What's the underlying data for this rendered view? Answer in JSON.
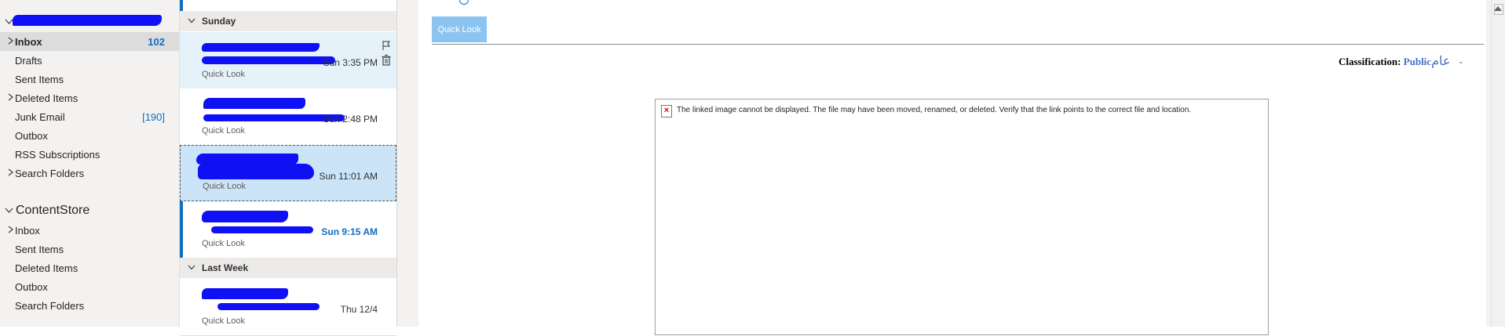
{
  "folder_pane": {
    "account1": {
      "items": [
        {
          "label": "Inbox",
          "count": "102",
          "chevron": true,
          "bold": true,
          "selected": true
        },
        {
          "label": "Drafts"
        },
        {
          "label": "Sent Items"
        },
        {
          "label": "Deleted Items",
          "chevron": true
        },
        {
          "label": "Junk Email",
          "count": "[190]"
        },
        {
          "label": "Outbox"
        },
        {
          "label": "RSS Subscriptions"
        },
        {
          "label": "Search Folders",
          "chevron": true
        }
      ]
    },
    "account2": {
      "name": "ContentStore",
      "items": [
        {
          "label": "Inbox",
          "chevron": true
        },
        {
          "label": "Sent Items"
        },
        {
          "label": "Deleted Items"
        },
        {
          "label": "Outbox"
        },
        {
          "label": "Search Folders"
        }
      ]
    }
  },
  "message_list": {
    "groups": [
      {
        "title": "Sunday"
      },
      {
        "title": "Last Week"
      }
    ],
    "messages": [
      {
        "time": "Sun 3:35 PM",
        "preview": "Quick Look",
        "state": "hover"
      },
      {
        "time": "Sun 2:48 PM",
        "preview": "Quick Look"
      },
      {
        "time": "Sun 11:01 AM",
        "preview": "Quick Look",
        "state": "selected"
      },
      {
        "time": "Sun 9:15 AM",
        "preview": "Quick Look",
        "state": "unread"
      },
      {
        "time": "Thu 12/4",
        "preview": "Quick Look"
      }
    ]
  },
  "reading_pane": {
    "quick_look_button": "Quick Look",
    "classification": {
      "label": "Classification:",
      "value": "Public",
      "arabic": "عام",
      "dash": "-"
    },
    "broken_image_message": "The linked image cannot be displayed.  The file may have been moved, renamed, or deleted. Verify that the link points to the correct file and location."
  },
  "colors": {
    "accent": "#106ebe",
    "redaction": "#1010f5",
    "selected_row": "#cce4f7",
    "quick_look_button": "#8cc4f1"
  }
}
